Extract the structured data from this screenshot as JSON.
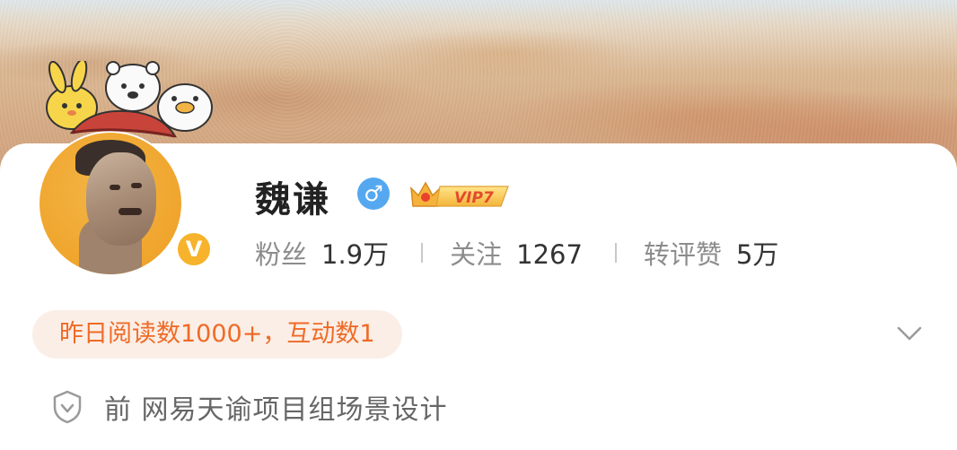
{
  "profile": {
    "name": "魏谦",
    "gender_symbol": "♂",
    "vip_label": "VIP7",
    "verified_symbol": "V"
  },
  "stats": [
    {
      "label": "粉丝",
      "value": "1.9万"
    },
    {
      "label": "关注",
      "value": "1267"
    },
    {
      "label": "转评赞",
      "value": "5万"
    }
  ],
  "highlight": {
    "text": "昨日阅读数1000+，互动数1"
  },
  "company": {
    "text": "前 网易天谕项目组场景设计"
  },
  "colors": {
    "accent_orange": "#ef6b27",
    "pill_bg": "#fbeee6",
    "gender_blue": "#55a8f0",
    "verified_gold": "#f6b32b"
  },
  "icons": {
    "gender": "male-icon",
    "verified": "verified-badge-icon",
    "vip": "crown-vip-icon",
    "expand": "chevron-down-icon",
    "company": "shield-icon"
  }
}
